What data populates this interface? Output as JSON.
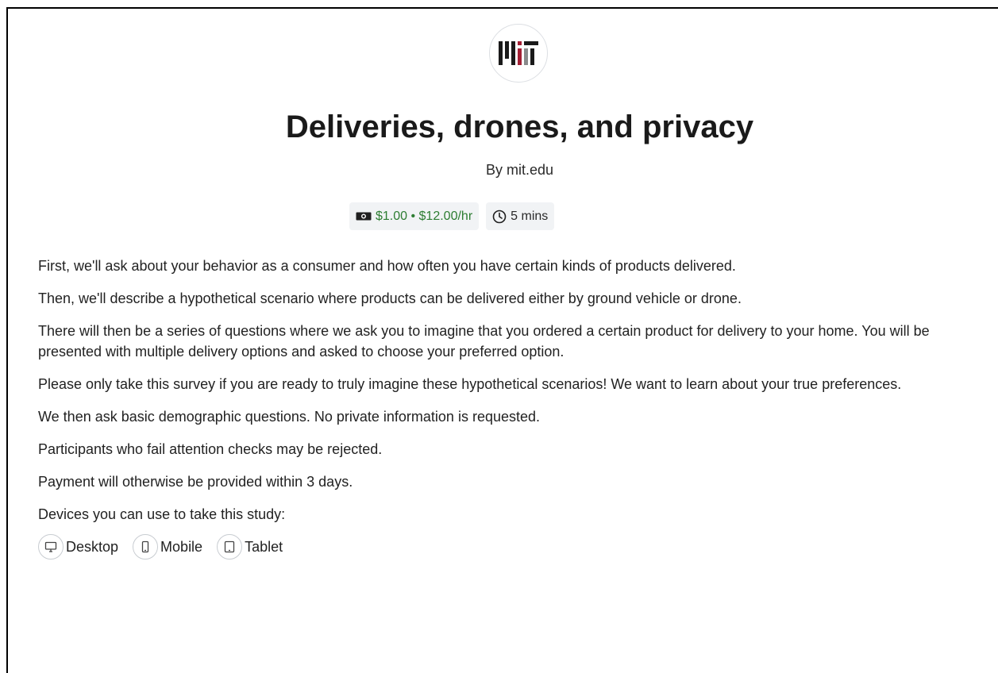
{
  "study": {
    "title": "Deliveries, drones, and privacy",
    "byline": "By mit.edu",
    "logo_text": "MIT",
    "reward": "$1.00 • $12.00/hr",
    "duration": "5 mins"
  },
  "description": [
    "First, we'll ask about your behavior as a consumer and how often you have certain kinds of products delivered.",
    "Then, we'll describe a hypothetical scenario where products can be delivered either by ground vehicle or drone.",
    "There will then be a series of questions where we ask you to imagine that you ordered a certain product for delivery to your home. You will be presented with multiple delivery options and asked to choose your preferred option.",
    "Please only take this survey if you are ready to truly imagine these hypothetical scenarios! We want to learn about your true preferences.",
    "We then ask basic demographic questions. No private information is requested.",
    "Participants who fail attention checks may be rejected.",
    "Payment will otherwise be provided within 3 days."
  ],
  "devices": {
    "heading": "Devices you can use to take this study:",
    "items": [
      {
        "label": "Desktop",
        "icon": "desktop-icon"
      },
      {
        "label": "Mobile",
        "icon": "mobile-icon"
      },
      {
        "label": "Tablet",
        "icon": "tablet-icon"
      }
    ]
  },
  "colors": {
    "reward_text": "#2d7d32",
    "badge_bg": "#f1f3f5",
    "mit_red": "#a31f34",
    "mit_gray": "#8a8b8c"
  },
  "icons": {
    "reward": "money-icon",
    "duration": "clock-icon"
  }
}
